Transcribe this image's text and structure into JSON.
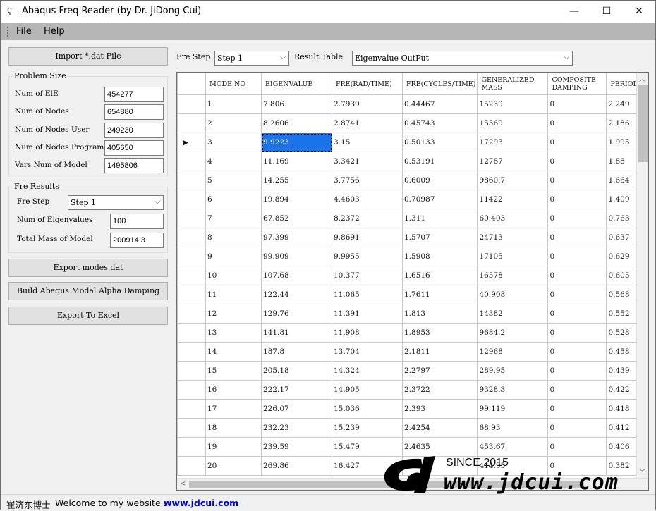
{
  "window": {
    "title": "Abaqus Freq Reader (by Dr. JiDong Cui)",
    "minimize_glyph": "—",
    "maximize_glyph": "☐",
    "close_glyph": "✕"
  },
  "menu": {
    "file": "File",
    "help": "Help"
  },
  "left": {
    "import_label": "Import *.dat File",
    "problem_size": {
      "legend": "Problem Size",
      "rows": [
        {
          "label": "Num of ElE",
          "value": "454277"
        },
        {
          "label": "Num of Nodes",
          "value": "654880"
        },
        {
          "label": "Num of Nodes User",
          "value": "249230"
        },
        {
          "label": "Num of Nodes Program",
          "value": "405650"
        },
        {
          "label": "Vars Num of Model",
          "value": "1495806"
        }
      ]
    },
    "fre_results": {
      "legend": "Fre Results",
      "step_label": "Fre Step",
      "step_value": "Step 1",
      "eig_label": "Num of Eigenvalues",
      "eig_value": "100",
      "mass_label": "Total Mass of Model",
      "mass_value": "200914.3"
    },
    "export_modes_label": "Export  modes.dat",
    "build_damping_label": "Build Abaqus Modal Alpha Damping",
    "export_excel_label": "Export To Excel"
  },
  "toolbar": {
    "fre_step_label": "Fre Step",
    "fre_step_value": "Step 1",
    "result_table_label": "Result Table",
    "result_table_value": "Eigenvalue OutPut"
  },
  "table": {
    "columns": [
      "MODE NO",
      "EIGENVALUE",
      "FRE(RAD/TIME)",
      "FRE(CYCLES/TIME)",
      "GENERALIZED MASS",
      "COMPOSITE DAMPING",
      "PERIOD"
    ],
    "selected_row": 2,
    "rows": [
      [
        "1",
        "7.806",
        "2.7939",
        "0.44467",
        "15239",
        "0",
        "2.249"
      ],
      [
        "2",
        "8.2606",
        "2.8741",
        "0.45743",
        "15569",
        "0",
        "2.186"
      ],
      [
        "3",
        "9.9223",
        "3.15",
        "0.50133",
        "17293",
        "0",
        "1.995"
      ],
      [
        "4",
        "11.169",
        "3.3421",
        "0.53191",
        "12787",
        "0",
        "1.88"
      ],
      [
        "5",
        "14.255",
        "3.7756",
        "0.6009",
        "9860.7",
        "0",
        "1.664"
      ],
      [
        "6",
        "19.894",
        "4.4603",
        "0.70987",
        "11422",
        "0",
        "1.409"
      ],
      [
        "7",
        "67.852",
        "8.2372",
        "1.311",
        "60.403",
        "0",
        "0.763"
      ],
      [
        "8",
        "97.399",
        "9.8691",
        "1.5707",
        "24713",
        "0",
        "0.637"
      ],
      [
        "9",
        "99.909",
        "9.9955",
        "1.5908",
        "17105",
        "0",
        "0.629"
      ],
      [
        "10",
        "107.68",
        "10.377",
        "1.6516",
        "16578",
        "0",
        "0.605"
      ],
      [
        "11",
        "122.44",
        "11.065",
        "1.7611",
        "40.908",
        "0",
        "0.568"
      ],
      [
        "12",
        "129.76",
        "11.391",
        "1.813",
        "14382",
        "0",
        "0.552"
      ],
      [
        "13",
        "141.81",
        "11.908",
        "1.8953",
        "9684.2",
        "0",
        "0.528"
      ],
      [
        "14",
        "187.8",
        "13.704",
        "2.1811",
        "12968",
        "0",
        "0.458"
      ],
      [
        "15",
        "205.18",
        "14.324",
        "2.2797",
        "289.95",
        "0",
        "0.439"
      ],
      [
        "16",
        "222.17",
        "14.905",
        "2.3722",
        "9328.3",
        "0",
        "0.422"
      ],
      [
        "17",
        "226.07",
        "15.036",
        "2.393",
        "99.119",
        "0",
        "0.418"
      ],
      [
        "18",
        "232.23",
        "15.239",
        "2.4254",
        "68.93",
        "0",
        "0.412"
      ],
      [
        "19",
        "239.59",
        "15.479",
        "2.4635",
        "453.67",
        "0",
        "0.406"
      ],
      [
        "20",
        "269.86",
        "16.427",
        "2.6145",
        "414.95",
        "0",
        "0.382"
      ]
    ]
  },
  "status": {
    "author": "崔济东博士",
    "welcome": "Welcome to my website :",
    "link": "www.jdcui.com"
  },
  "watermark": {
    "since": "SINCE 2015",
    "url": "www.jdcui.com"
  },
  "colors": {
    "selection": "#1a73e8",
    "menubar": "#b6b6b6",
    "link": "#0000cc"
  }
}
